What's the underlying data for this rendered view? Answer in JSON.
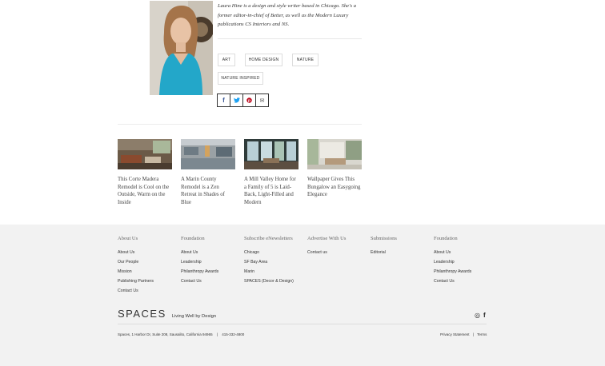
{
  "author": {
    "bio_name": "Laura Hine",
    "bio_rest_1": " is a design and style writer based in Chicago. She's a former editor-in-chief of ",
    "bio_pub1": "Better",
    "bio_rest_2": ", as well as the Modern Luxury publications ",
    "bio_pub2": "CS Interiors",
    "bio_rest_3": " and ",
    "bio_pub3": "NS",
    "bio_end": "."
  },
  "tags": [
    "ART",
    "HOME DESIGN",
    "NATURE",
    "NATURE INSPIRED"
  ],
  "share": [
    {
      "icon": "facebook-icon",
      "glyph": "f",
      "color": "#3b5998"
    },
    {
      "icon": "twitter-icon",
      "glyph": "🐦",
      "color": "#1da1f2"
    },
    {
      "icon": "pinterest-icon",
      "glyph": "℗",
      "color": "#bd081c"
    },
    {
      "icon": "email-icon",
      "glyph": "✉",
      "color": "#555555"
    }
  ],
  "related": [
    {
      "title": "This Corte Madera Remodel is Cool on the Outside, Warm on the Inside"
    },
    {
      "title": "A Marin County Remodel is a Zen Retreat in Shades of Blue"
    },
    {
      "title": "A Mill Valley Home for a Family of 5 is Laid-Back, Light-Filled and Modern"
    },
    {
      "title": "Wallpaper Gives This Bungalow an Easygoing Elegance"
    }
  ],
  "footer": {
    "columns": [
      {
        "title": "About Us",
        "links": [
          "About Us",
          "Our People",
          "Mission",
          "Publishing Partners",
          "Contact Us"
        ]
      },
      {
        "title": "Foundation",
        "links": [
          "About Us",
          "Leadership",
          "Philanthropy Awards",
          "Contact Us"
        ]
      },
      {
        "title": "Subscribe eNewsletters",
        "links": [
          "Chicago",
          "SF Bay Area",
          "Marin",
          "SPACES (Decor & Design)"
        ]
      },
      {
        "title": "Advertise With Us",
        "links": [
          "Contact us"
        ]
      },
      {
        "title": "Submissions",
        "links": [
          "Editorial"
        ]
      },
      {
        "title": "Foundation",
        "links": [
          "About Us",
          "Leadership",
          "Philanthropy Awards",
          "Contact Us"
        ]
      }
    ],
    "brand_logo": "SPACES",
    "brand_tagline": "Living Well by Design",
    "social": [
      {
        "icon": "instagram-icon",
        "glyph": "◎"
      },
      {
        "icon": "facebook-icon",
        "glyph": "f"
      }
    ],
    "address": "Spaces, 1 Harbor Dr, Suite 208, Sausalito, California 94965",
    "separator": "|",
    "phone": "415-332-4800",
    "privacy": "Privacy Statement",
    "terms": "Terms"
  }
}
